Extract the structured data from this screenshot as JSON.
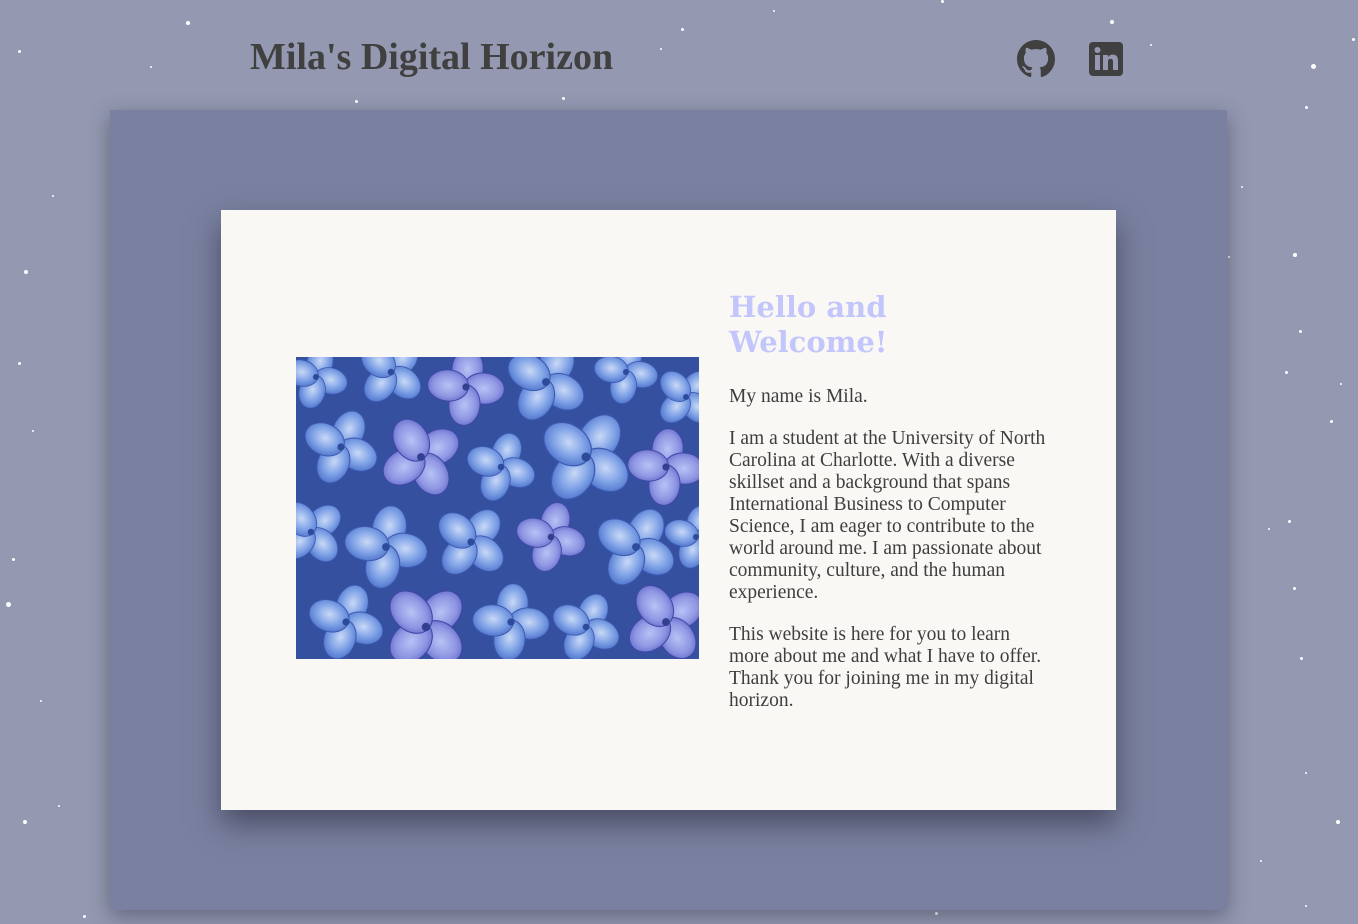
{
  "header": {
    "title": "Mila's Digital Horizon",
    "icons": [
      "github-icon",
      "linkedin-icon"
    ]
  },
  "intro": {
    "heading_line1": "Hello and",
    "heading_line2": "Welcome!",
    "paragraph1": "My name is Mila.",
    "paragraph2": "I am a student at the University of North Carolina at Charlotte. With a diverse skillset and a background that spans International Business to Computer Science, I am eager to contribute to the world around me. I am passionate about community, culture, and the human experience.",
    "paragraph3": "This website is here for you to learn more about me and what I have to offer. Thank you for joining me in my digital horizon."
  },
  "colors": {
    "page_background": "#9499b1",
    "panel_background": "#7a80a0",
    "card_background": "#faf8f5",
    "heading_accent": "#c3c6fb",
    "text": "#3e3e3e"
  }
}
